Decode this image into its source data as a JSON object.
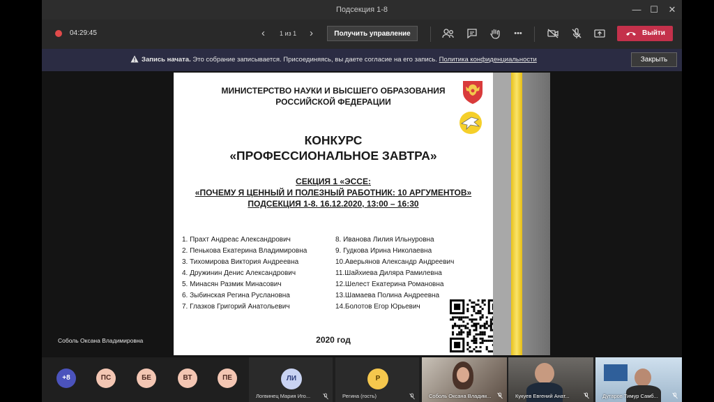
{
  "window": {
    "title": "Подсекция 1-8"
  },
  "toolbar": {
    "timer": "04:29:45",
    "page_indicator": "1 из 1",
    "take_control_label": "Получить управление",
    "leave_label": "Выйти",
    "more_label": "•••"
  },
  "banner": {
    "bold": "Запись начата.",
    "text": " Это собрание записывается. Присоединяясь, вы даете согласие на его запись. ",
    "link": "Политика конфиденциальности",
    "close_label": "Закрыть"
  },
  "presenter": {
    "name": "Соболь Оксана Владимировна"
  },
  "slide": {
    "ministry_line1": "МИНИСТЕРСТВО НАУКИ И ВЫСШЕГО ОБРАЗОВАНИЯ",
    "ministry_line2": "РОССИЙСКОЙ ФЕДЕРАЦИИ",
    "contest_line1": "КОНКУРС",
    "contest_line2": "«ПРОФЕССИОНАЛЬНОЕ ЗАВТРА»",
    "section_line1": "СЕКЦИЯ 1 «ЭССЕ:",
    "section_line2": "«ПОЧЕМУ Я ЦЕННЫЙ И ПОЛЕЗНЫЙ РАБОТНИК: 10 АРГУМЕНТОВ»",
    "section_line3": "ПОДСЕКЦИЯ 1-8. 16.12.2020, 13:00 – 16:30",
    "list_left": [
      "1.  Прахт Андреас Александрович",
      "2.  Пенькова Екатерина Владимировна",
      "3.  Тихомирова Виктория Андреевна",
      "4.  Дружинин Денис Александрович",
      "5.  Минасян Размик Минасович",
      "6.  Зыбинская Регина Руслановна",
      "7.  Глазков Григорий Анатольевич"
    ],
    "list_right": [
      "8.  Иванова Лилия Ильнуровна",
      "9.  Гудкова Ирина Николаевна",
      "10.Аверьянов Александр Андреевич",
      "11.Шайхиева Диляра Рамилевна",
      "12.Шелест Екатерина Романовна",
      "13.Шамаева Полина Андреевна",
      "14.Болотов Егор Юрьевич"
    ],
    "year": "2020 год"
  },
  "participants": {
    "more_count": "+8",
    "avatars": [
      "ПС",
      "БЕ",
      "ВТ",
      "ПЕ"
    ],
    "tiles": [
      {
        "initials": "ЛИ",
        "name": "Логвинец Мария Иго...",
        "bg": "#c9d3f2",
        "fg": "#2b3a78"
      },
      {
        "initials": "Р",
        "name": "Регина (гость)",
        "bg": "#f5c74d",
        "fg": "#5a3e00"
      }
    ],
    "videos": [
      {
        "name": "Соболь Оксана Владим..."
      },
      {
        "name": "Кукуев Евгений Анат..."
      },
      {
        "name": "Дутаров Тимур Самб..."
      }
    ]
  }
}
